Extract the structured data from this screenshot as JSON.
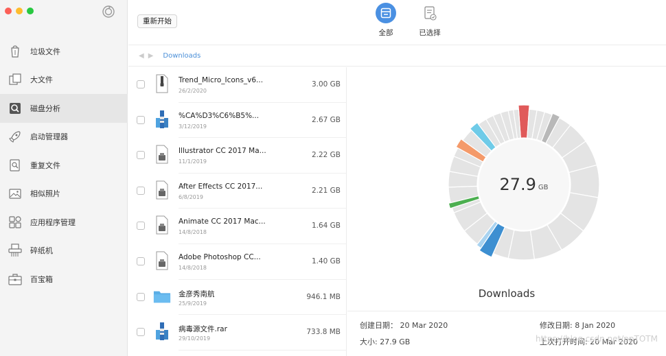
{
  "window": {
    "controls": [
      "close",
      "minimize",
      "zoom"
    ]
  },
  "sidebar": {
    "items": [
      {
        "label": "垃圾文件",
        "icon": "trash-bin-icon",
        "active": false
      },
      {
        "label": "大文件",
        "icon": "large-files-icon",
        "active": false
      },
      {
        "label": "磁盘分析",
        "icon": "disk-analysis-icon",
        "active": true
      },
      {
        "label": "启动管理器",
        "icon": "rocket-icon",
        "active": false
      },
      {
        "label": "重复文件",
        "icon": "duplicate-files-icon",
        "active": false
      },
      {
        "label": "相似照片",
        "icon": "photo-icon",
        "active": false
      },
      {
        "label": "应用程序管理",
        "icon": "apps-grid-icon",
        "active": false
      },
      {
        "label": "碎纸机",
        "icon": "shredder-icon",
        "active": false
      },
      {
        "label": "百宝箱",
        "icon": "toolbox-icon",
        "active": false
      }
    ]
  },
  "toolbar": {
    "restart_label": "重新开始",
    "all_label": "全部",
    "selected_label": "已选择"
  },
  "breadcrumb": {
    "path": "Downloads"
  },
  "files": [
    {
      "name": "Trend_Micro_Icons_v6...",
      "date": "26/2/2020",
      "size": "3.00 GB",
      "icon": "zip-archive-icon"
    },
    {
      "name": "%CA%D3%C6%B5%...",
      "date": "3/12/2019",
      "size": "2.67 GB",
      "icon": "rar-archive-icon"
    },
    {
      "name": "Illustrator CC 2017 Ma...",
      "date": "11/1/2019",
      "size": "2.22 GB",
      "icon": "disk-image-icon"
    },
    {
      "name": "After Effects CC 2017...",
      "date": "6/8/2019",
      "size": "2.21 GB",
      "icon": "disk-image-icon"
    },
    {
      "name": "Animate CC 2017 Mac...",
      "date": "14/8/2018",
      "size": "1.64 GB",
      "icon": "disk-image-icon"
    },
    {
      "name": "Adobe Photoshop CC...",
      "date": "14/8/2018",
      "size": "1.40 GB",
      "icon": "disk-image-icon"
    },
    {
      "name": "金彦秀南航",
      "date": "25/9/2019",
      "size": "946.1 MB",
      "icon": "folder-icon"
    },
    {
      "name": "病毒源文件.rar",
      "date": "29/10/2019",
      "size": "733.8 MB",
      "icon": "rar-archive-icon"
    }
  ],
  "detail": {
    "total_value": "27.9",
    "total_unit": "GB",
    "folder_name": "Downloads",
    "created": "创建日期：  20 Mar 2020",
    "size": "大小: 27.9 GB",
    "modified": "修改日期: 8 Jan 2020",
    "last_opened": "上次打开时间: 20 Mar 2020"
  },
  "watermark": "https://blog.csdn.net/ppTOTM",
  "colors": {
    "accent": "#4a90e2",
    "red": "#e05a5a",
    "gray_dark": "#b8b8b8",
    "cyan": "#6fcbe8",
    "orange": "#f49a6a",
    "green": "#4caf50",
    "blue": "#3d8fd1",
    "light_blue": "#a9d3f0",
    "segment": "#e4e4e4"
  }
}
